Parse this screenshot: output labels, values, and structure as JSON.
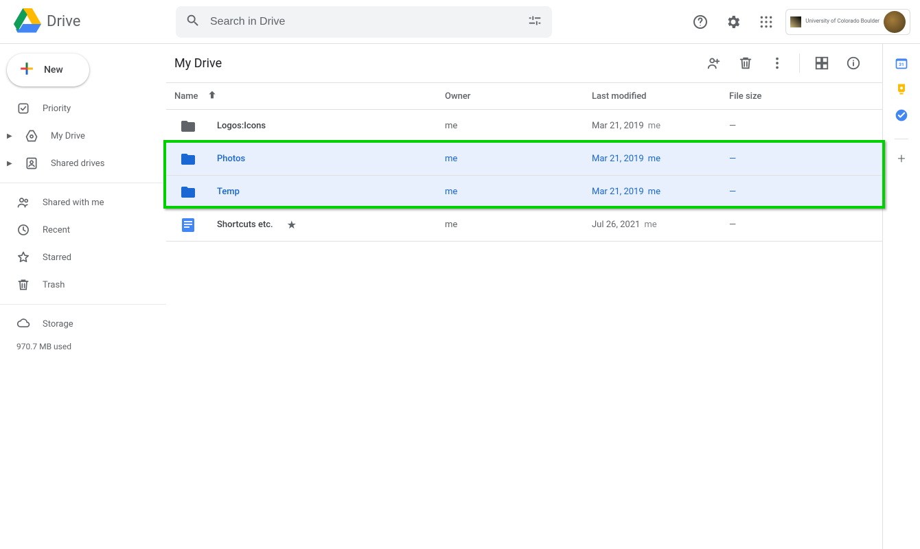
{
  "header": {
    "app_name": "Drive",
    "search_placeholder": "Search in Drive",
    "org_name": "University of Colorado Boulder"
  },
  "sidebar": {
    "new_label": "New",
    "items": [
      {
        "label": "Priority"
      },
      {
        "label": "My Drive"
      },
      {
        "label": "Shared drives"
      },
      {
        "label": "Shared with me"
      },
      {
        "label": "Recent"
      },
      {
        "label": "Starred"
      },
      {
        "label": "Trash"
      },
      {
        "label": "Storage"
      }
    ],
    "storage_used": "970.7 MB used"
  },
  "main": {
    "title": "My Drive",
    "columns": {
      "name": "Name",
      "owner": "Owner",
      "modified": "Last modified",
      "size": "File size"
    },
    "rows": [
      {
        "name": "Logos:Icons",
        "owner": "me",
        "modified": "Mar 21, 2019",
        "mod_user": "me",
        "size": "—",
        "type": "folder",
        "selected": false,
        "starred": false
      },
      {
        "name": "Photos",
        "owner": "me",
        "modified": "Mar 21, 2019",
        "mod_user": "me",
        "size": "—",
        "type": "folder",
        "selected": true,
        "starred": false
      },
      {
        "name": "Temp",
        "owner": "me",
        "modified": "Mar 21, 2019",
        "mod_user": "me",
        "size": "—",
        "type": "folder",
        "selected": true,
        "starred": false
      },
      {
        "name": "Shortcuts etc.",
        "owner": "me",
        "modified": "Jul 26, 2021",
        "mod_user": "me",
        "size": "—",
        "type": "doc",
        "selected": false,
        "starred": true
      }
    ]
  }
}
